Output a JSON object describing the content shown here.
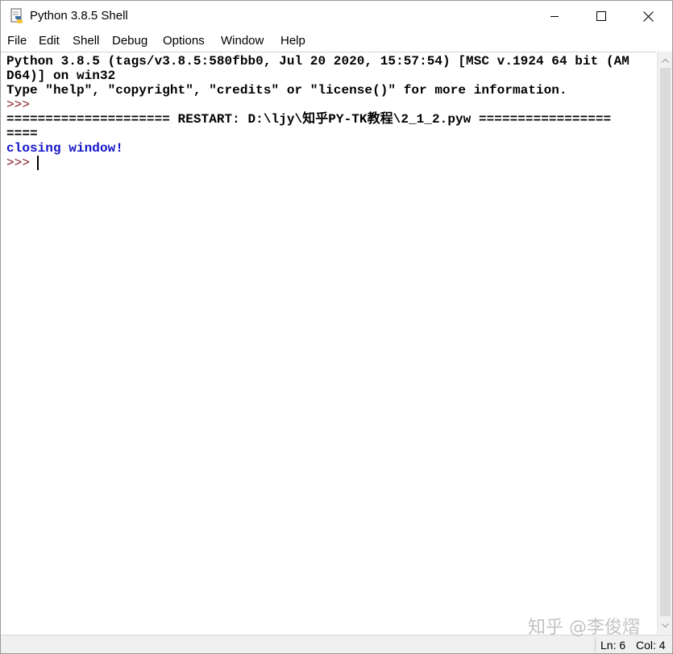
{
  "window": {
    "title": "Python 3.8.5 Shell",
    "icon": "python-idle-icon",
    "controls": [
      "minimize-icon",
      "maximize-icon",
      "close-icon"
    ]
  },
  "menu": [
    "File",
    "Edit",
    "Shell",
    "Debug",
    "Options",
    "Window",
    "Help"
  ],
  "shell": {
    "banner_line1": "Python 3.8.5 (tags/v3.8.5:580fbb0, Jul 20 2020, 15:57:54) [MSC v.1924 64 bit (AM",
    "banner_line2": "D64)] on win32",
    "banner_line3": "Type \"help\", \"copyright\", \"credits\" or \"license()\" for more information.",
    "prompt1": ">>>",
    "restart_line1": "===================== RESTART: D:\\ljy\\知乎PY-TK教程\\2_1_2.pyw =================",
    "restart_line2": "====",
    "output": "closing window!",
    "prompt2": ">>>"
  },
  "status": {
    "line": "Ln: 6",
    "col": "Col: 4"
  },
  "watermark": "知乎 @李俊熠",
  "colors": {
    "prompt": "#8b1e24",
    "output": "#1313c8",
    "text": "#000000"
  }
}
